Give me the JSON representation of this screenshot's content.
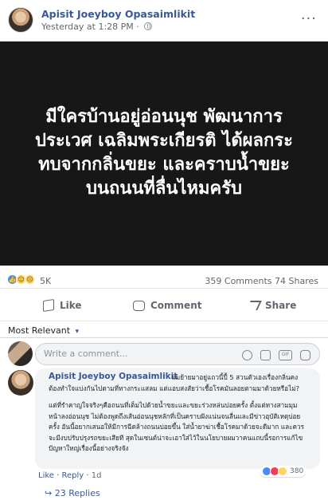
{
  "post": {
    "author": "Apisit Joeyboy Opasaimlikit",
    "timestamp": "Yesterday at 1:28 PM",
    "separator": "·",
    "more_menu": "···",
    "headline": "มีใครบ้านอยู่อ่อนนุช พัฒนาการ\nประเวศ เฉลิมพระเกียรติ ได้ผลกระ\nทบจากกลิ่นขยะ และคราบน้ำขยะ\nบนถนนที่ลื่นไหมครับ",
    "reaction_count": "5K",
    "comments_count": "359 Comments",
    "shares_count": "74 Shares",
    "actions": {
      "like": "Like",
      "comment": "Comment",
      "share": "Share"
    }
  },
  "comments": {
    "sort_label": "Most Relevant",
    "sort_arrow": "▾",
    "input_placeholder": "Write a comment...",
    "featured": {
      "author": "Apisit Joeyboy Opasaimlikit",
      "text_1": "ผมย้ายมาอยู่แถวนี้ปี้ 5 สวนตัวเองเรื่องกลิ่นคงต้องทำใจแบ่งกันไปตามที่ทางกระแสลม แต่แอบสงสัยว่าเชื้อโรคมันลอยตามมาด้วยหรือไม่?",
      "text_2": "แต่ที่รำคาญใจจริงๆคือถนนที่เต็มไปด้วยน้ำขยะและขยะร่วงหล่นบ่อยครั้ง ตั้งแต่ทางสามมุมหน้าลงอ่อนนุช ไม่ต้องพูดถึงเส้นอ่อนนุชหลักที่เป็นคราบฝังแน่นจนลื่นและมีข่าวอุบัติเหตุบ่อยครั้ง อันนี้อยากเสนอให้มีการฉีดล้างถนนบ่อยขึ้น ใส่น้ำยาฆ่าเชื้อโรคมาด้วยจะดีมาก และควรจะมีงบปรับปรุงรถขยะเสียที สุดในเซนต์น่าจะเอาใส่ไว้ในนโยบายผมวาคนแถบนี้รอการแก้ไขปัญหาใหญ่เรื่องนี้อย่างจริงจัง",
      "meta_like": "Like",
      "meta_reply": "Reply",
      "meta_time": "1d",
      "reaction_count": "380"
    },
    "replies_label": "23 Replies"
  }
}
